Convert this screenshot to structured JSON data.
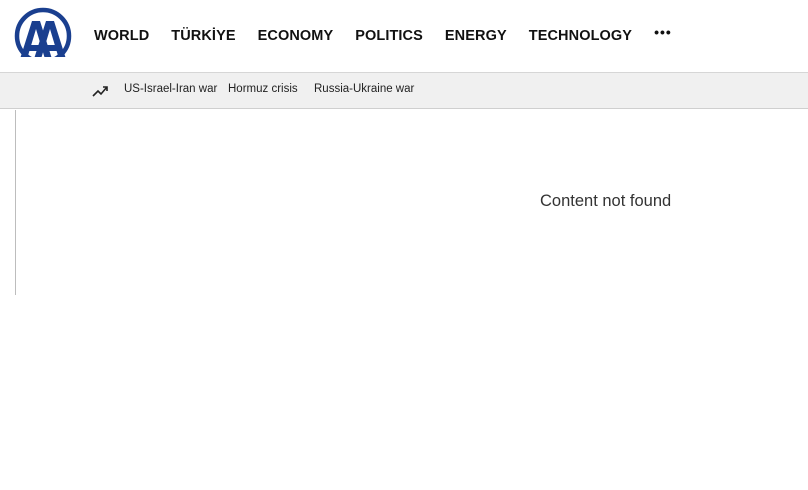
{
  "brand": {
    "logo_icon": "aa-logo-icon",
    "color": "#1a3f8f"
  },
  "nav": {
    "items": [
      {
        "label": "WORLD"
      },
      {
        "label": "TÜRKİYE"
      },
      {
        "label": "ECONOMY"
      },
      {
        "label": "POLITICS"
      },
      {
        "label": "ENERGY"
      },
      {
        "label": "TECHNOLOGY"
      }
    ],
    "more_label": "•••"
  },
  "trending": {
    "icon": "trending-up-icon",
    "links": [
      {
        "label": "US-Israel-Iran war"
      },
      {
        "label": "Hormuz crisis"
      },
      {
        "label": "Russia-Ukraine war"
      }
    ]
  },
  "main": {
    "message": "Content not found"
  }
}
